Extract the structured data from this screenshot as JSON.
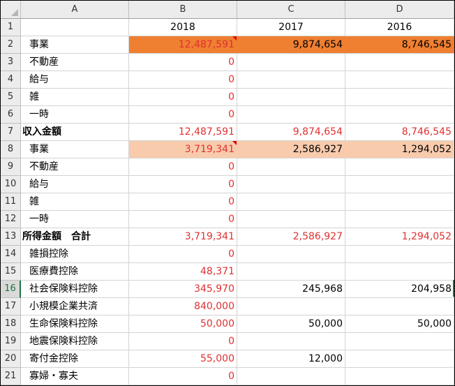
{
  "columns": [
    "A",
    "B",
    "C",
    "D"
  ],
  "header_values": {
    "b": "2018",
    "c": "2017",
    "d": "2016"
  },
  "rows": [
    {
      "num": "1",
      "a": "",
      "b": "",
      "c": "",
      "d": ""
    },
    {
      "num": "2",
      "a": "事業",
      "b": "12,487,591",
      "c": "9,874,654",
      "d": "8,746,545"
    },
    {
      "num": "3",
      "a": "不動産",
      "b": "0",
      "c": "",
      "d": ""
    },
    {
      "num": "4",
      "a": "給与",
      "b": "0",
      "c": "",
      "d": ""
    },
    {
      "num": "5",
      "a": "雑",
      "b": "0",
      "c": "",
      "d": ""
    },
    {
      "num": "6",
      "a": "一時",
      "b": "0",
      "c": "",
      "d": ""
    },
    {
      "num": "7",
      "a": "収入金額",
      "b": "12,487,591",
      "c": "9,874,654",
      "d": "8,746,545"
    },
    {
      "num": "8",
      "a": "事業",
      "b": "3,719,341",
      "c": "2,586,927",
      "d": "1,294,052"
    },
    {
      "num": "9",
      "a": "不動産",
      "b": "0",
      "c": "",
      "d": ""
    },
    {
      "num": "10",
      "a": "給与",
      "b": "0",
      "c": "",
      "d": ""
    },
    {
      "num": "11",
      "a": "雑",
      "b": "0",
      "c": "",
      "d": ""
    },
    {
      "num": "12",
      "a": "一時",
      "b": "0",
      "c": "",
      "d": ""
    },
    {
      "num": "13",
      "a": "所得金額　合計",
      "b": "3,719,341",
      "c": "2,586,927",
      "d": "1,294,052"
    },
    {
      "num": "14",
      "a": "雑損控除",
      "b": "0",
      "c": "",
      "d": ""
    },
    {
      "num": "15",
      "a": "医療費控除",
      "b": "48,371",
      "c": "",
      "d": ""
    },
    {
      "num": "16",
      "a": "社会保険料控除",
      "b": "345,970",
      "c": "245,968",
      "d": "204,958"
    },
    {
      "num": "17",
      "a": "小規模企業共済",
      "b": "840,000",
      "c": "",
      "d": ""
    },
    {
      "num": "18",
      "a": "生命保険料控除",
      "b": "50,000",
      "c": "50,000",
      "d": "50,000"
    },
    {
      "num": "19",
      "a": "地震保険料控除",
      "b": "0",
      "c": "",
      "d": ""
    },
    {
      "num": "20",
      "a": "寄付金控除",
      "b": "55,000",
      "c": "12,000",
      "d": ""
    },
    {
      "num": "21",
      "a": "寡婦・寡夫",
      "b": "0",
      "c": "",
      "d": ""
    }
  ],
  "colors": {
    "fill_dark": "#ef7f31",
    "fill_light": "#f8cbad",
    "negative_red": "#e03030",
    "selection_green": "#217346"
  }
}
